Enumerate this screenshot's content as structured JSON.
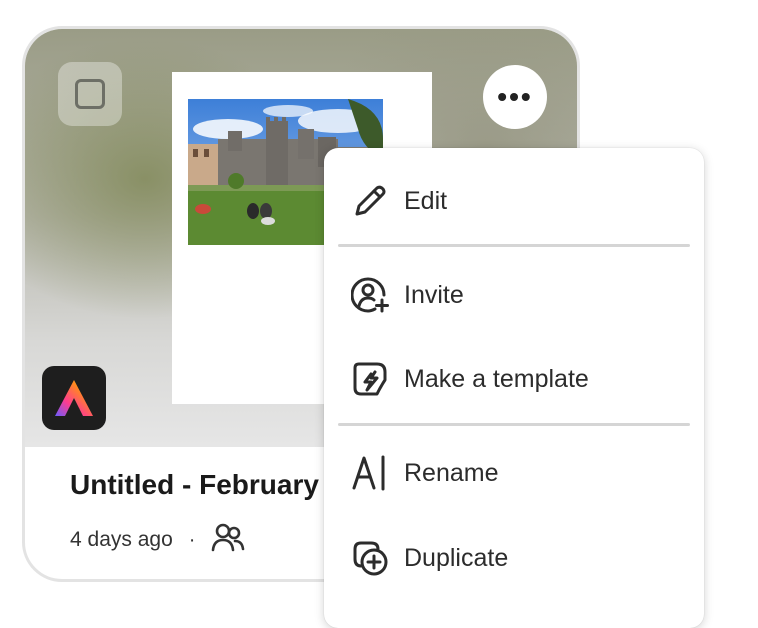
{
  "card": {
    "title": "Untitled - February",
    "timestamp": "4 days ago",
    "separator": "·",
    "icons": {
      "select": "checkbox-square-icon",
      "more": "more-horizontal-icon",
      "app": "adobe-express-logo",
      "shared": "shared-users-icon"
    }
  },
  "menu": {
    "items": [
      {
        "label": "Edit",
        "icon": "pencil-icon"
      },
      {
        "label": "Invite",
        "icon": "invite-user-icon"
      },
      {
        "label": "Make a template",
        "icon": "template-icon"
      },
      {
        "label": "Rename",
        "icon": "rename-icon"
      },
      {
        "label": "Duplicate",
        "icon": "duplicate-icon"
      }
    ]
  },
  "more_button_label": "•••",
  "colors": {
    "menu_bg": "#ffffff",
    "separator": "#d5d5d5",
    "app_logo_bg": "#1e1e1e"
  }
}
